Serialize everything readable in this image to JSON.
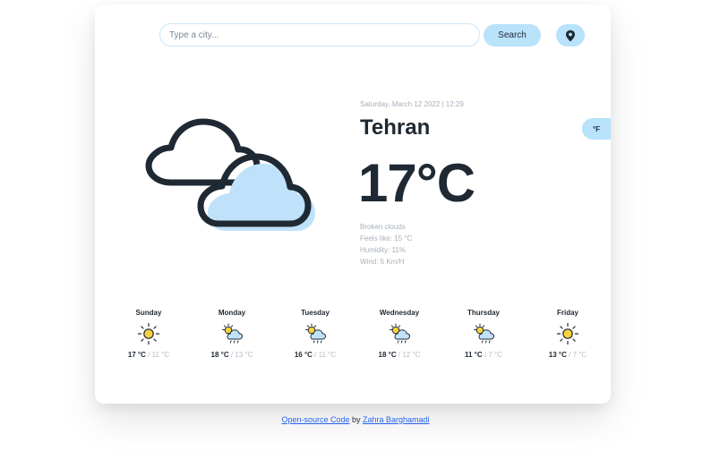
{
  "search": {
    "placeholder": "Type a city...",
    "value": "",
    "button_label": "Search"
  },
  "location_button": {
    "icon": "location-pin-icon"
  },
  "unit_toggle": {
    "label": "°F"
  },
  "current": {
    "icon": "cloud-icon",
    "date_time": "Saturday, March 12 2022 | 12:29",
    "city": "Tehran",
    "temperature": "17°C",
    "description": "Broken clouds",
    "feels_like": "Feels like: 15 °C",
    "humidity": "Humidity: 11%",
    "wind": "Wind: 5 Km/H"
  },
  "forecast": [
    {
      "day": "Sunday",
      "icon": "sun-icon",
      "high": "17 °C",
      "low": "11 °C"
    },
    {
      "day": "Monday",
      "icon": "sun-rain-cloud-icon",
      "high": "18 °C",
      "low": "13 °C"
    },
    {
      "day": "Tuesday",
      "icon": "sun-rain-cloud-icon",
      "high": "16 °C",
      "low": "11 °C"
    },
    {
      "day": "Wednesday",
      "icon": "sun-rain-cloud-icon",
      "high": "18 °C",
      "low": "12 °C"
    },
    {
      "day": "Thursday",
      "icon": "sun-rain-cloud-icon",
      "high": "11 °C",
      "low": "7 °C"
    },
    {
      "day": "Friday",
      "icon": "sun-icon",
      "high": "13 °C",
      "low": "7 °C"
    }
  ],
  "footer": {
    "code_link": "Open-source Code",
    "by_text": " by ",
    "author_link": "Zahra Barghamadi"
  },
  "colors": {
    "accent": "#b9e2fb",
    "text": "#1f2933",
    "muted": "#a7b0ba",
    "sun": "#f6d33c",
    "cloud_fill": "#bfe2fa",
    "link": "#2563eb"
  }
}
